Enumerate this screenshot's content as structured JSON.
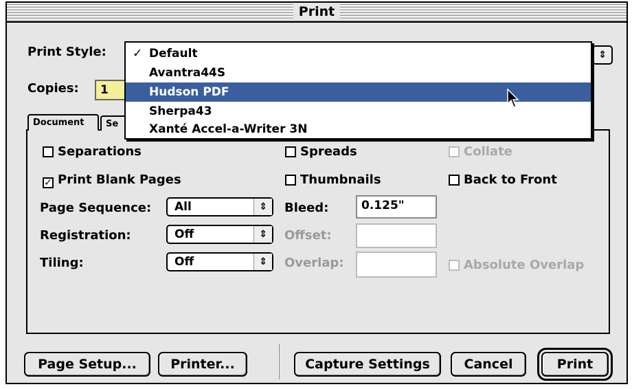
{
  "window": {
    "title": "Print"
  },
  "print_style": {
    "label": "Print Style:",
    "options": [
      {
        "label": "Default",
        "checked": true,
        "highlighted": false
      },
      {
        "label": "Avantra44S",
        "checked": false,
        "highlighted": false
      },
      {
        "label": "Hudson PDF",
        "checked": false,
        "highlighted": true
      },
      {
        "label": "Sherpa43",
        "checked": false,
        "highlighted": false
      },
      {
        "label": "Xanté Accel-a-Writer 3N",
        "checked": false,
        "highlighted": false
      }
    ],
    "check_glyph": "✓"
  },
  "copies": {
    "label": "Copies:",
    "value": "1"
  },
  "tabs": {
    "document": "Document",
    "setup_partial": "Se"
  },
  "options": {
    "separations": {
      "label": "Separations",
      "checked": false,
      "enabled": true
    },
    "spreads": {
      "label": "Spreads",
      "checked": false,
      "enabled": true
    },
    "collate": {
      "label": "Collate",
      "checked": false,
      "enabled": false
    },
    "print_blank_pages": {
      "label": "Print Blank Pages",
      "checked": true,
      "enabled": true
    },
    "thumbnails": {
      "label": "Thumbnails",
      "checked": false,
      "enabled": true
    },
    "back_to_front": {
      "label": "Back to Front",
      "checked": false,
      "enabled": true
    },
    "absolute_overlap": {
      "label": "Absolute Overlap",
      "checked": false,
      "enabled": false
    }
  },
  "page_sequence": {
    "label": "Page Sequence:",
    "value": "All"
  },
  "registration": {
    "label": "Registration:",
    "value": "Off"
  },
  "tiling": {
    "label": "Tiling:",
    "value": "Off"
  },
  "bleed": {
    "label": "Bleed:",
    "value": "0.125\""
  },
  "offset": {
    "label": "Offset:",
    "value": ""
  },
  "overlap": {
    "label": "Overlap:",
    "value": ""
  },
  "buttons": {
    "page_setup": "Page Setup...",
    "printer": "Printer...",
    "capture_settings": "Capture Settings",
    "cancel": "Cancel",
    "print": "Print"
  },
  "icons": {
    "popup_arrows": "⇕",
    "checkmark": "✓",
    "pointer": "arrow-pointer-icon"
  },
  "colors": {
    "highlight": "#3b5f9d",
    "copies_field": "#f5ef9a",
    "window_bg": "#e6e6e6"
  }
}
